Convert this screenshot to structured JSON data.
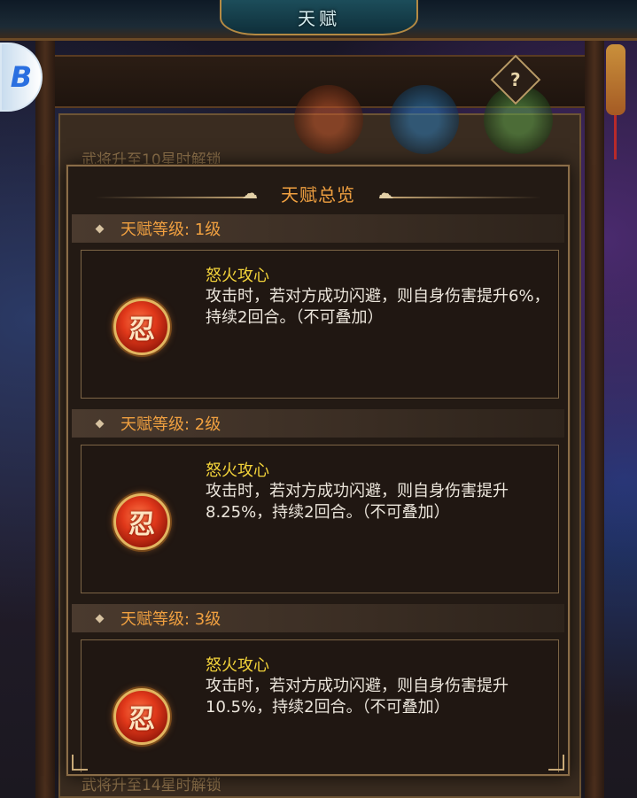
{
  "screen": {
    "title": "天赋",
    "help_label": "?",
    "side_badge_label": "B",
    "underlay_top_text": "武将升至10星时解锁",
    "underlay_bottom_text": "武将升至14星时解锁"
  },
  "modal": {
    "title": "天赋总览",
    "levels": [
      {
        "label": "天赋等级: 1级",
        "talent_name": "怒火攻心",
        "description": "攻击时，若对方成功闪避，则自身伤害提升6%，持续2回合。（不可叠加）"
      },
      {
        "label": "天赋等级: 2级",
        "talent_name": "怒火攻心",
        "description": "攻击时，若对方成功闪避，则自身伤害提升8.25%，持续2回合。（不可叠加）"
      },
      {
        "label": "天赋等级: 3级",
        "talent_name": "怒火攻心",
        "description": "攻击时，若对方成功闪避，则自身伤害提升10.5%，持续2回合。（不可叠加）"
      }
    ]
  },
  "colors": {
    "title_orange": "#f0a040",
    "talent_name_yellow": "#f2d23a",
    "desc_text": "#ece6dc",
    "frame_border": "#8a6d48"
  },
  "icons": {
    "talent_icon": "rage-talent-icon",
    "help_icon": "help-icon"
  }
}
